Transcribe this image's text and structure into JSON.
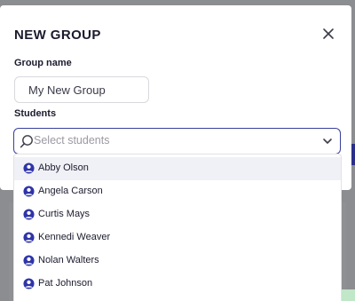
{
  "modal": {
    "title": "NEW GROUP",
    "close_icon": "close-icon"
  },
  "group_name": {
    "label": "Group name",
    "value": "My New Group"
  },
  "students": {
    "label": "Students",
    "placeholder": "Select students",
    "search_icon": "search-icon",
    "chevron_icon": "chevron-down-icon",
    "options": [
      {
        "label": "Abby Olson",
        "icon": "user-circle-icon",
        "highlighted": true
      },
      {
        "label": "Angela Carson",
        "icon": "user-circle-icon",
        "highlighted": false
      },
      {
        "label": "Curtis Mays",
        "icon": "user-circle-icon",
        "highlighted": false
      },
      {
        "label": "Kennedi Weaver",
        "icon": "user-circle-icon",
        "highlighted": false
      },
      {
        "label": "Nolan Walters",
        "icon": "user-circle-icon",
        "highlighted": false
      },
      {
        "label": "Pat Johnson",
        "icon": "user-circle-icon",
        "highlighted": false
      }
    ]
  },
  "colors": {
    "accent": "#3a3f9c",
    "icon_blue": "#2f34a8",
    "highlight": "#f0f1f6",
    "text": "#1b1b2e",
    "placeholder": "#9a9aa3"
  }
}
